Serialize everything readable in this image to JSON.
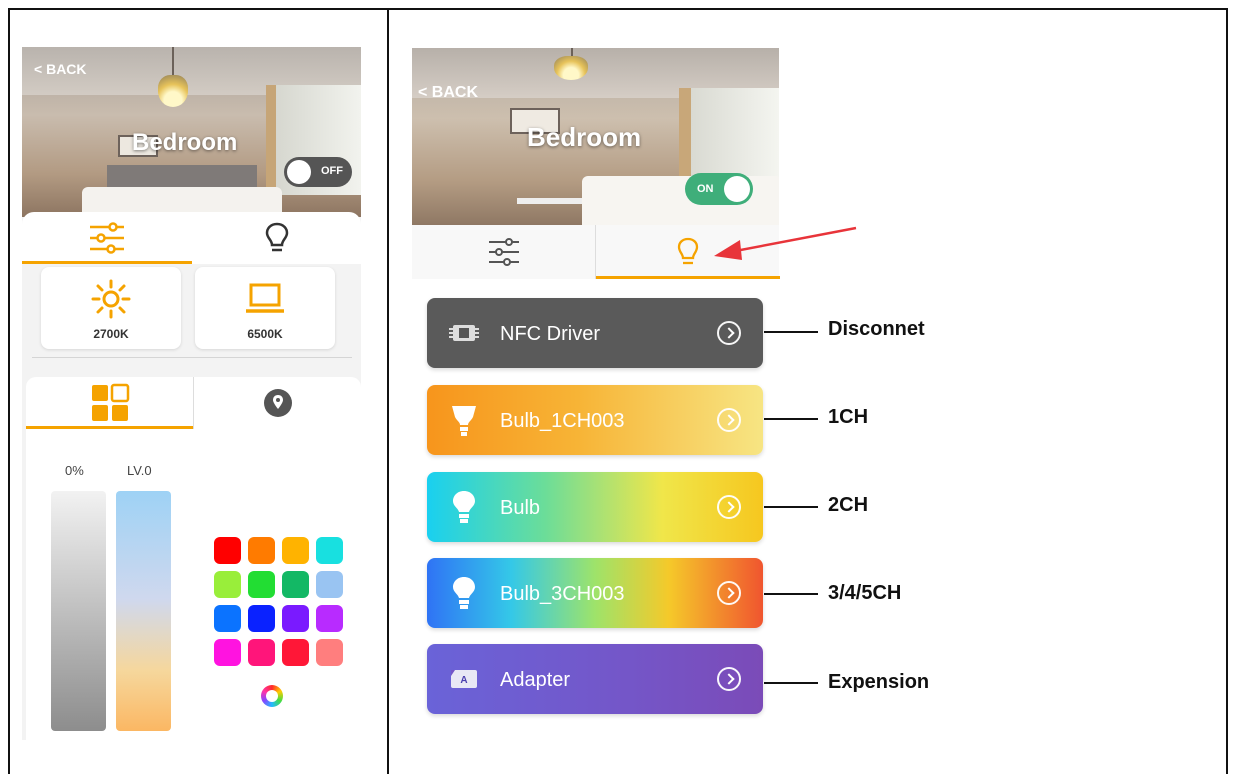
{
  "left": {
    "back_label": "BACK",
    "room_title": "Bedroom",
    "power_toggle": "OFF",
    "tabs": [
      {
        "icon": "sliders-icon",
        "active": true
      },
      {
        "icon": "bulb-icon",
        "active": false
      }
    ],
    "cct_presets": [
      {
        "icon": "sun-icon",
        "label": "2700K"
      },
      {
        "icon": "laptop-icon",
        "label": "6500K"
      }
    ],
    "sub_tabs": [
      {
        "icon": "grid-icon",
        "active": true
      },
      {
        "icon": "location-pin-icon",
        "active": false
      }
    ],
    "brightness_label": "0%",
    "level_label": "LV.0",
    "swatches": [
      "#ff0000",
      "#ff7b00",
      "#ffb300",
      "#18e0e0",
      "#99ee3a",
      "#22dd33",
      "#13b865",
      "#99c4f2",
      "#0b73ff",
      "#0a22ff",
      "#7a1aff",
      "#b82bff",
      "#ff13e0",
      "#ff157a",
      "#ff1737",
      "#ff7e7e"
    ],
    "accent_color": "#f5a300"
  },
  "right": {
    "back_label": "BACK",
    "room_title": "Bedroom",
    "power_toggle": "ON",
    "tabs": [
      {
        "icon": "sliders-icon",
        "active": false
      },
      {
        "icon": "bulb-icon",
        "active": true
      }
    ],
    "devices": [
      {
        "name": "NFC Driver",
        "icon": "nfc-chip-icon",
        "annotation": "Disconnet"
      },
      {
        "name": "Bulb_1CH003",
        "icon": "floodlight-bulb-icon",
        "annotation": "1CH"
      },
      {
        "name": "Bulb",
        "icon": "bulb-icon",
        "annotation": "2CH"
      },
      {
        "name": "Bulb_3CH003",
        "icon": "bulb-icon",
        "annotation": "3/4/5CH"
      },
      {
        "name": "Adapter",
        "icon": "adapter-icon",
        "annotation": "Expension"
      }
    ],
    "pointer_color": "#e8343a",
    "accent_color": "#f5a300"
  }
}
